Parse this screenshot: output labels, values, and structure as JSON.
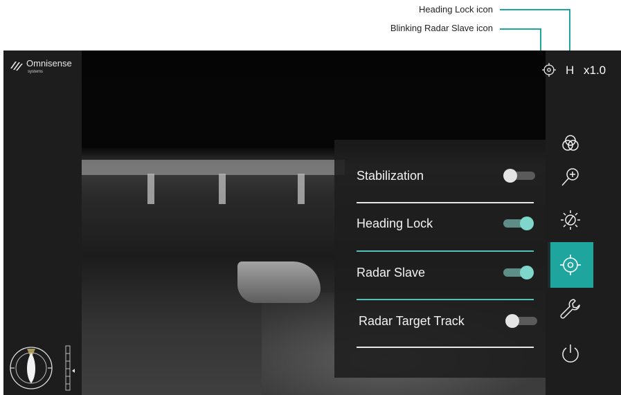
{
  "annotations": {
    "heading_lock": "Heading Lock icon",
    "radar_slave": "Blinking Radar Slave icon"
  },
  "brand": {
    "name": "Omnisense",
    "sub": "systems"
  },
  "status_bar": {
    "heading_indicator": "H",
    "zoom": "x1.0",
    "icons": [
      "radar-slave-icon",
      "heading-lock-indicator"
    ]
  },
  "side_menu": {
    "items": [
      {
        "name": "color-palette",
        "icon": "color-palette-icon",
        "active": false
      },
      {
        "name": "zoom-in",
        "icon": "zoom-in-icon",
        "active": false
      },
      {
        "name": "brightness-contrast",
        "icon": "brightness-contrast-icon",
        "active": false
      },
      {
        "name": "target-tracking",
        "icon": "crosshair-icon",
        "active": true
      },
      {
        "name": "settings",
        "icon": "wrench-icon",
        "active": false
      },
      {
        "name": "power",
        "icon": "power-icon",
        "active": false
      }
    ]
  },
  "panel": {
    "items": [
      {
        "label": "Stabilization",
        "on": false
      },
      {
        "label": "Heading Lock",
        "on": true
      },
      {
        "label": "Radar Slave",
        "on": true
      },
      {
        "label": "Radar Target Track",
        "on": false
      }
    ]
  },
  "colors": {
    "accent": "#1ea69e",
    "toggle_on": "#7fd7cc",
    "divider_active": "#52c2b8",
    "divider": "#e8e8e8"
  }
}
